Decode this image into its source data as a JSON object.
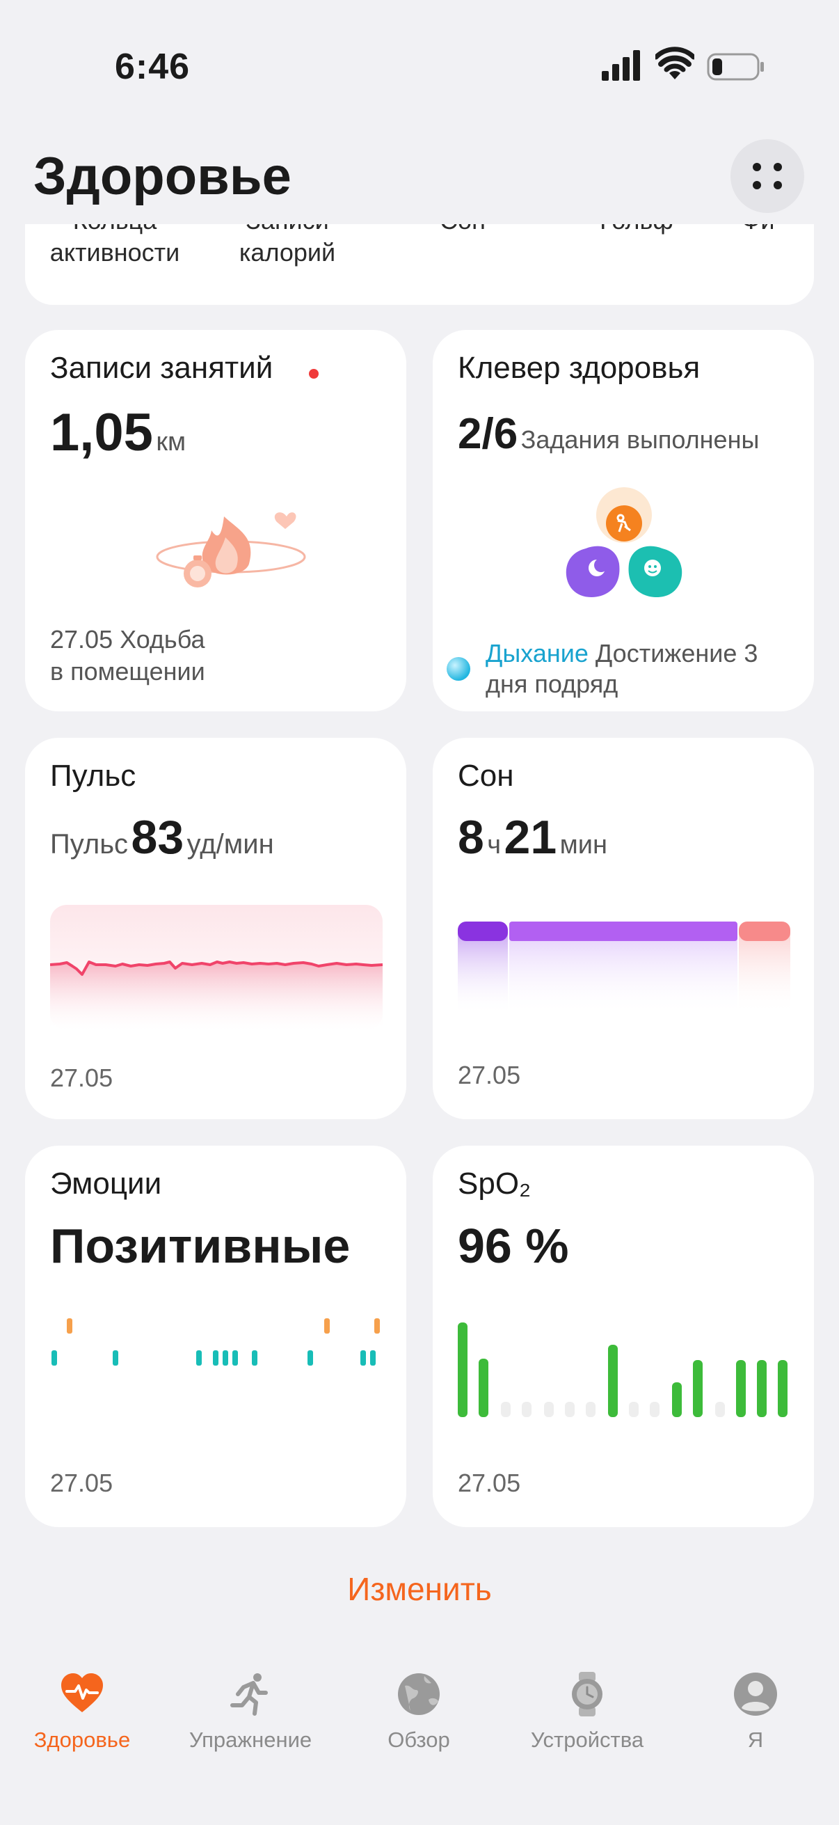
{
  "status_bar": {
    "time": "6:46"
  },
  "header": {
    "title": "Здоровье"
  },
  "categories": [
    {
      "label": "Кольца\nактивности"
    },
    {
      "label": "Записи\nкалорий"
    },
    {
      "label": "Сон"
    },
    {
      "label": "Гольф"
    },
    {
      "label": "Фи"
    }
  ],
  "cards": {
    "activity": {
      "title": "Записи занятий",
      "value": "1,05",
      "unit": "км",
      "desc_line1": "27.05 Ходьба",
      "desc_line2": "в помещении"
    },
    "clover": {
      "title": "Клевер здоровья",
      "value": "2/6",
      "value_label": "Задания выполнены",
      "link": "Дыхание",
      "note_line1": " Достижение 3",
      "note_line2": "дня подряд"
    },
    "pulse": {
      "title": "Пульс",
      "prefix": "Пульс",
      "value": "83",
      "unit": "уд/мин",
      "date": "27.05"
    },
    "sleep": {
      "title": "Сон",
      "hours": "8",
      "hours_unit": "ч",
      "minutes": "21",
      "minutes_unit": "мин",
      "date": "27.05"
    },
    "emotions": {
      "title": "Эмоции",
      "value": "Позитивные",
      "date": "27.05"
    },
    "spo2": {
      "title": "SpO₂",
      "value": "96 %",
      "date": "27.05"
    }
  },
  "edit_label": "Изменить",
  "bottom_nav": [
    {
      "label": "Здоровье",
      "active": true
    },
    {
      "label": "Упражнение",
      "active": false
    },
    {
      "label": "Обзор",
      "active": false
    },
    {
      "label": "Устройства",
      "active": false
    },
    {
      "label": "Я",
      "active": false
    }
  ],
  "colors": {
    "accent": "#f5651d",
    "pulse_line": "#f0446a",
    "sleep_deep": "#8a33e0",
    "sleep_light": "#b260f2",
    "sleep_rem": "#f78a8a",
    "emotion_positive": "#f6a04c",
    "emotion_calm": "#18bdb7",
    "spo2_bar": "#3dbb3a",
    "link": "#19a3cf"
  }
}
